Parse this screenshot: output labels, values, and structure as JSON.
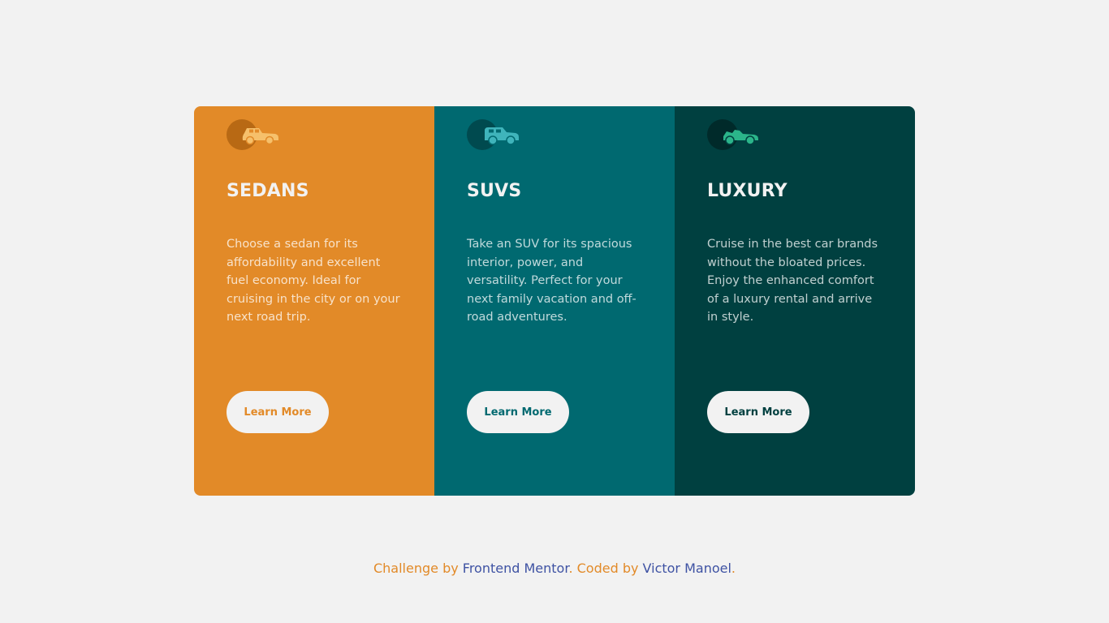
{
  "colors": {
    "page_bg": "#f2f2f2",
    "sedans_bg": "#e28a28",
    "suvs_bg": "#006970",
    "luxury_bg": "#004040",
    "button_bg": "#f2f2f2",
    "footer_text": "#e28a28",
    "footer_link": "#3e52a3"
  },
  "cards": [
    {
      "icon": "sedan-car-icon",
      "title": "SEDANS",
      "description": "Choose a sedan for its affordability and excellent fuel economy. Ideal for cruising in the city or on your next road trip.",
      "button_label": "Learn More"
    },
    {
      "icon": "suv-car-icon",
      "title": "SUVS",
      "description": "Take an SUV for its spacious interior, power, and versatility. Perfect for your next family vacation and off-road adventures.",
      "button_label": "Learn More"
    },
    {
      "icon": "luxury-car-icon",
      "title": "LUXURY",
      "description": "Cruise in the best car brands without the bloated prices. Enjoy the enhanced comfort of a luxury rental and arrive in style.",
      "button_label": "Learn More"
    }
  ],
  "footer": {
    "challenge_by": "Challenge by ",
    "frontend_mentor": "Frontend Mentor",
    "coded_by": ". Coded by ",
    "author": "Victor Manoel",
    "end": "."
  }
}
